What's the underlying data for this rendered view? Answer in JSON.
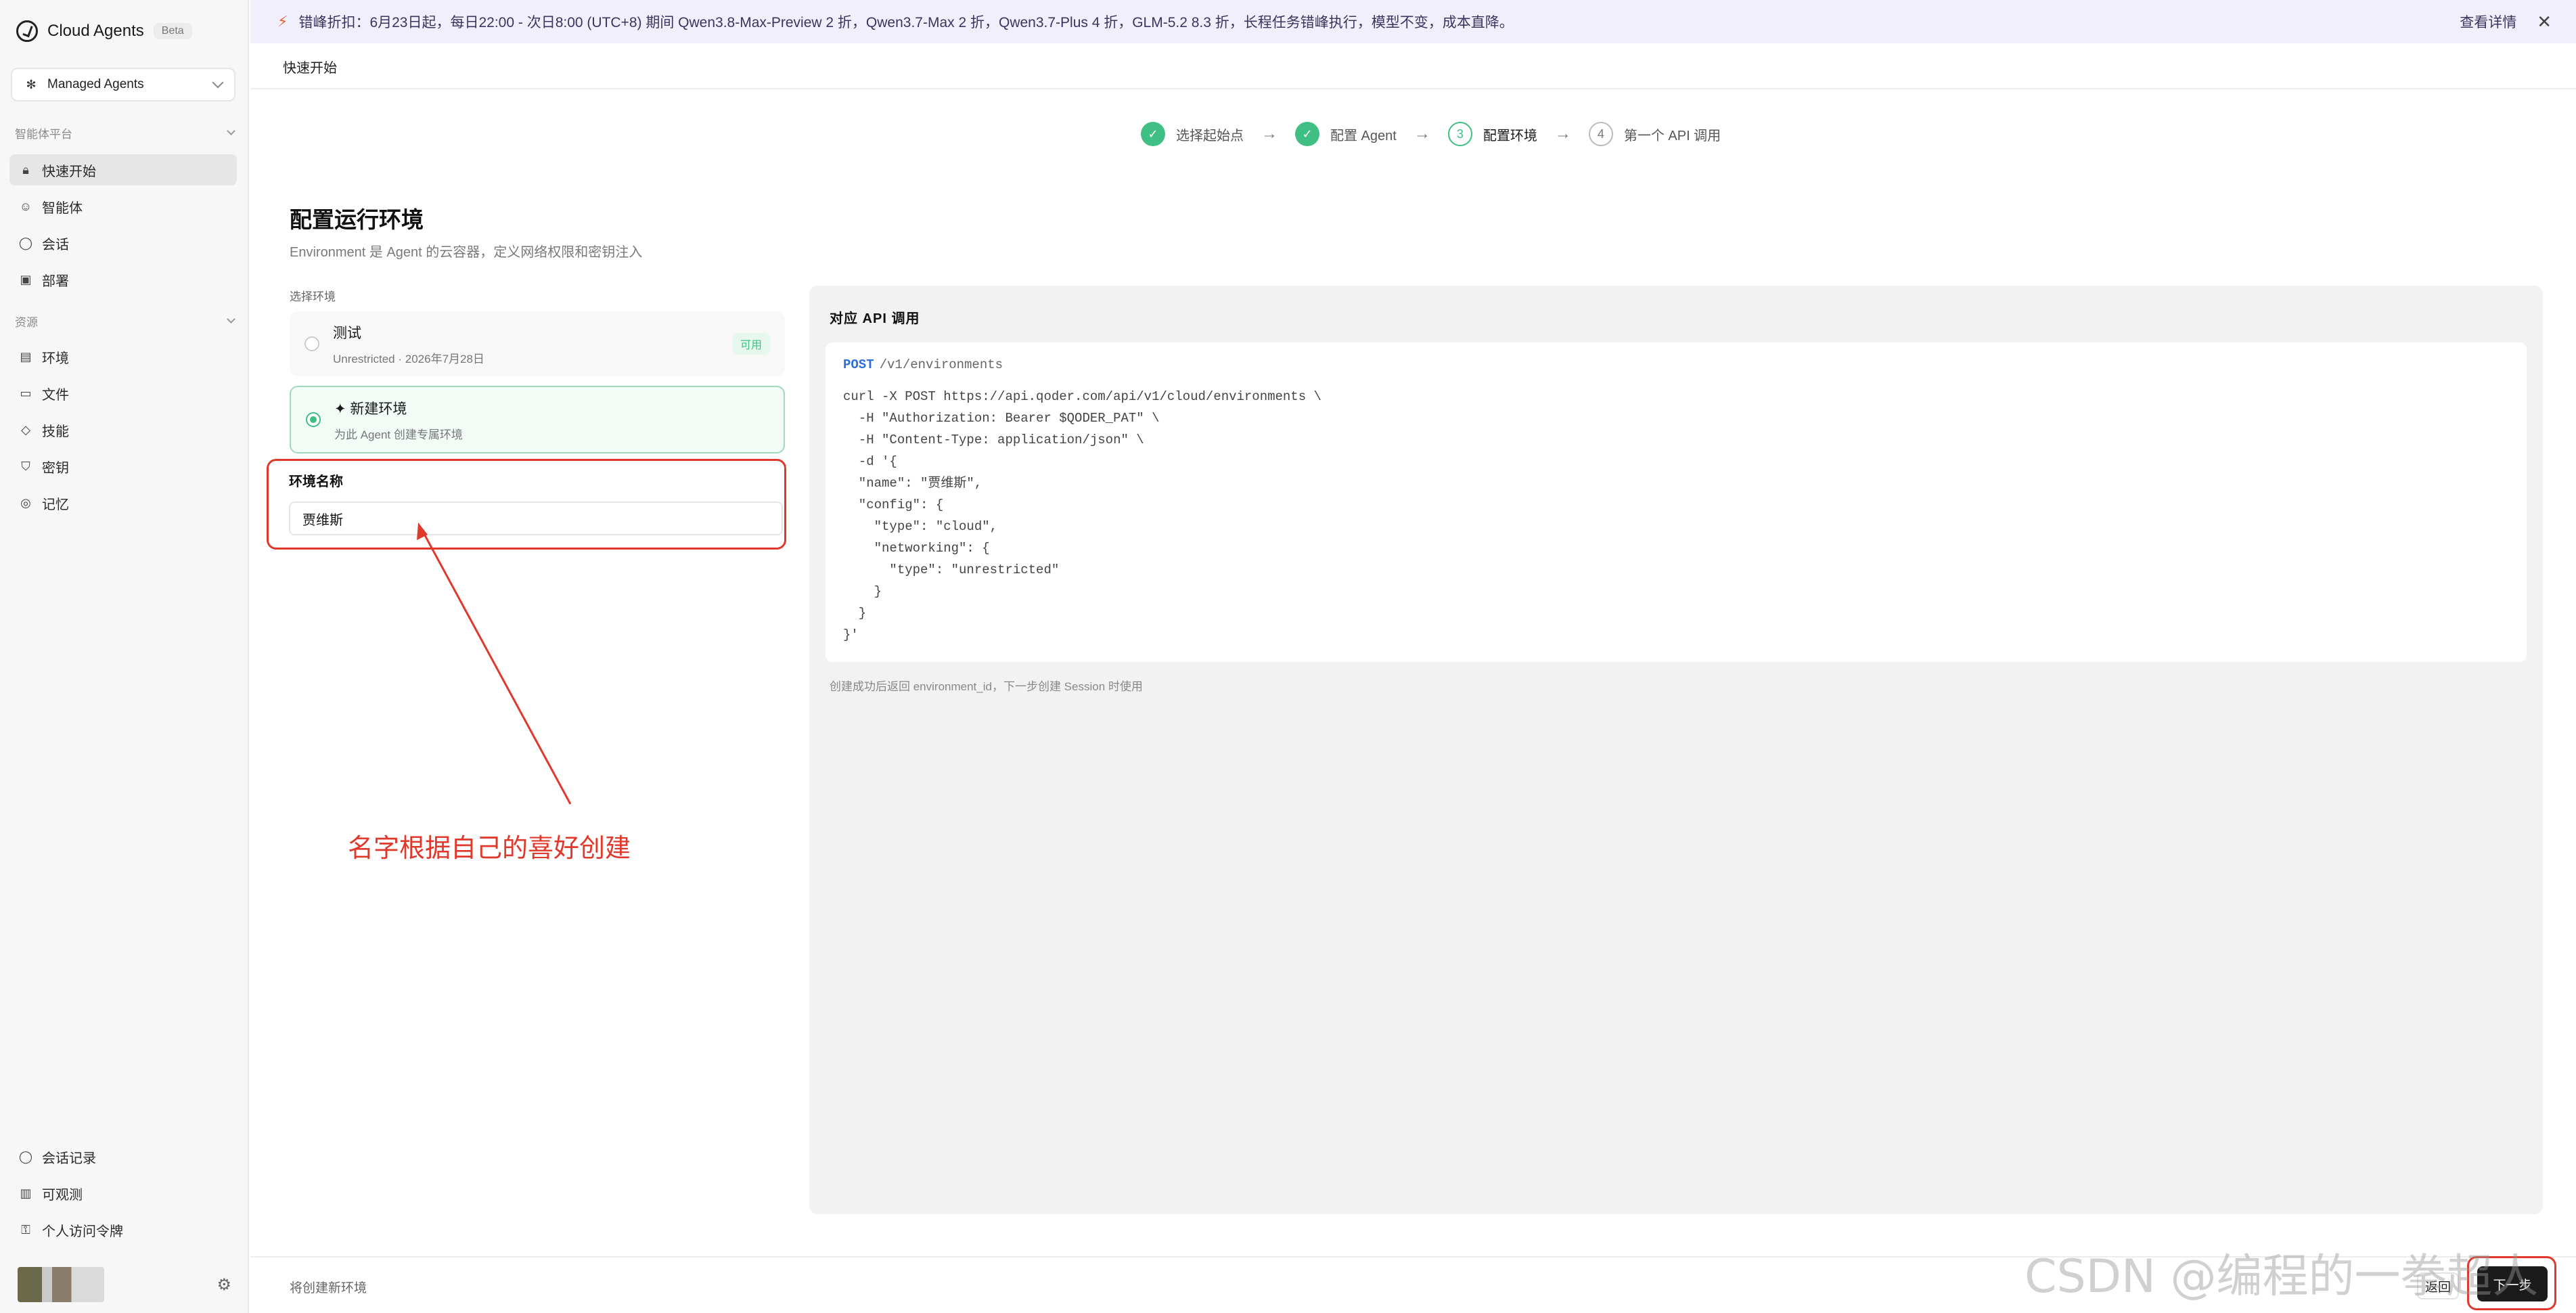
{
  "app": {
    "name": "Cloud Agents",
    "badge": "Beta"
  },
  "workspace": {
    "selected": "Managed Agents"
  },
  "sidebar": {
    "section_platform": "智能体平台",
    "section_resources": "资源",
    "platform_items": [
      {
        "label": "快速开始",
        "icon": "lock-icon"
      },
      {
        "label": "智能体",
        "icon": "agent-icon"
      },
      {
        "label": "会话",
        "icon": "chat-icon"
      },
      {
        "label": "部署",
        "icon": "deploy-icon"
      }
    ],
    "resource_items": [
      {
        "label": "环境",
        "icon": "environment-icon"
      },
      {
        "label": "文件",
        "icon": "folder-icon"
      },
      {
        "label": "技能",
        "icon": "skill-icon"
      },
      {
        "label": "密钥",
        "icon": "shield-icon"
      },
      {
        "label": "记忆",
        "icon": "memory-icon"
      }
    ],
    "bottom_items": [
      {
        "label": "会话记录",
        "icon": "chat-history-icon"
      },
      {
        "label": "可观测",
        "icon": "chart-icon"
      },
      {
        "label": "个人访问令牌",
        "icon": "key-icon"
      }
    ]
  },
  "banner": {
    "text": "错峰折扣：6月23日起，每日22:00 - 次日8:00 (UTC+8) 期间 Qwen3.8-Max-Preview 2 折，Qwen3.7-Max 2 折，Qwen3.7-Plus 4 折，GLM-5.2 8.3 折，长程任务错峰执行，模型不变，成本直降。",
    "link": "查看详情"
  },
  "breadcrumb": "快速开始",
  "stepper": {
    "steps": [
      {
        "label": "选择起始点",
        "state": "done",
        "num": "✓"
      },
      {
        "label": "配置 Agent",
        "state": "done",
        "num": "✓"
      },
      {
        "label": "配置环境",
        "state": "current",
        "num": "3"
      },
      {
        "label": "第一个 API 调用",
        "state": "todo",
        "num": "4"
      }
    ],
    "arrow": "→"
  },
  "page": {
    "title": "配置运行环境",
    "subtitle": "Environment 是 Agent 的云容器，定义网络权限和密钥注入",
    "select_label": "选择环境"
  },
  "environments": {
    "test": {
      "title": "测试",
      "subtitle": "Unrestricted · 2026年7月28日",
      "badge": "可用"
    },
    "new": {
      "title": "✦ 新建环境",
      "subtitle": "为此 Agent 创建专属环境"
    }
  },
  "env_name": {
    "label": "环境名称",
    "value": "贾维斯"
  },
  "annotation": "名字根据自己的喜好创建",
  "api": {
    "title": "对应 API 调用",
    "method": "POST",
    "path": "/v1/environments",
    "code": "curl -X POST https://api.qoder.com/api/v1/cloud/environments \\\n  -H \"Authorization: Bearer $QODER_PAT\" \\\n  -H \"Content-Type: application/json\" \\\n  -d '{\n  \"name\": \"贾维斯\",\n  \"config\": {\n    \"type\": \"cloud\",\n    \"networking\": {\n      \"type\": \"unrestricted\"\n    }\n  }\n}'",
    "note": "创建成功后返回 environment_id，下一步创建 Session 时使用"
  },
  "footer": {
    "note": "将创建新环境",
    "back": "返回",
    "next": "下一步"
  },
  "watermark": "CSDN @编程的一拳超人",
  "colors": {
    "accent_green": "#3fbf83",
    "annotation_red": "#e0382b",
    "banner_bg": "#f1effb"
  }
}
